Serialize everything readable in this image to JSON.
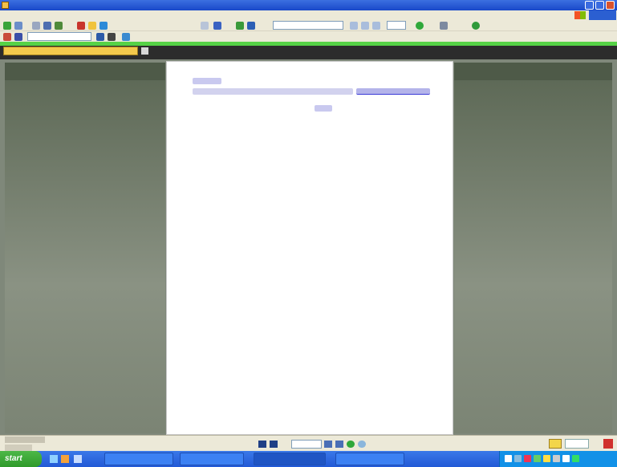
{
  "window": {
    "title": "",
    "controls": [
      "minimize",
      "maximize",
      "close"
    ]
  },
  "menu": {
    "items": [
      "",
      "",
      "",
      "",
      "",
      "",
      ""
    ]
  },
  "toolbar": {
    "search_value": "",
    "zoom_value": ""
  },
  "document_tab": {
    "label": ""
  },
  "document": {
    "line1": "",
    "line2_text": "",
    "line2_link": "",
    "line3": ""
  },
  "statusbar": {
    "page_size": "",
    "bookmarks_label": "",
    "page_number": ""
  },
  "taskbar": {
    "start_label": "start",
    "tasks": [
      "",
      "",
      "",
      "",
      ""
    ],
    "clock": ""
  },
  "colors": {
    "titlebar": "#1948c9",
    "panel": "#7f887a",
    "page": "#ffffff",
    "link": "#3a3ad6",
    "taskbar": "#2259d6",
    "start": "#2f9a2b"
  },
  "icons": [
    "app-icon",
    "back-icon",
    "forward-icon",
    "print-icon",
    "search-icon",
    "zoom-in-icon",
    "zoom-out-icon",
    "first-page-icon",
    "previous-page-icon",
    "next-page-icon",
    "last-page-icon",
    "windows-logo-icon"
  ]
}
